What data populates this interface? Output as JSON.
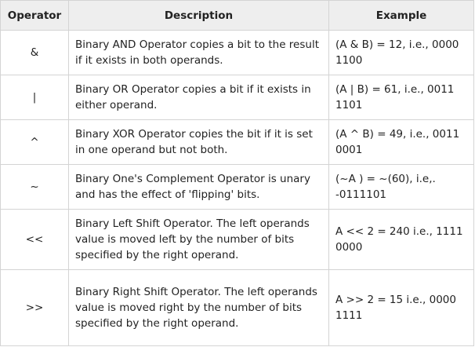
{
  "table": {
    "headers": [
      "Operator",
      "Description",
      "Example"
    ],
    "rows": [
      {
        "operator": "&",
        "description": "Binary AND Operator copies a bit to the result if it exists in both operands.",
        "example": "(A & B) = 12, i.e., 0000 1100"
      },
      {
        "operator": "|",
        "description": "Binary OR Operator copies a bit if it exists in either operand.",
        "example": "(A | B) = 61, i.e., 0011 1101"
      },
      {
        "operator": "^",
        "description": "Binary XOR Operator copies the bit if it is set in one operand but not both.",
        "example": "(A ^ B) = 49, i.e., 0011 0001"
      },
      {
        "operator": "~",
        "description": "Binary One's Complement Operator is unary and has the effect of 'flipping' bits.",
        "example": "(~A ) = ~(60), i.e,. -0111101"
      },
      {
        "operator": "<<",
        "description": "Binary Left Shift Operator. The left operands value is moved left by the number of bits specified by the right operand.",
        "example": "A << 2 = 240 i.e., 1111 0000"
      },
      {
        "operator": ">>",
        "description": "Binary Right Shift Operator. The left operands value is moved right by the number of bits specified by the right operand.",
        "example": "A >> 2 = 15 i.e., 0000 1111"
      }
    ]
  }
}
